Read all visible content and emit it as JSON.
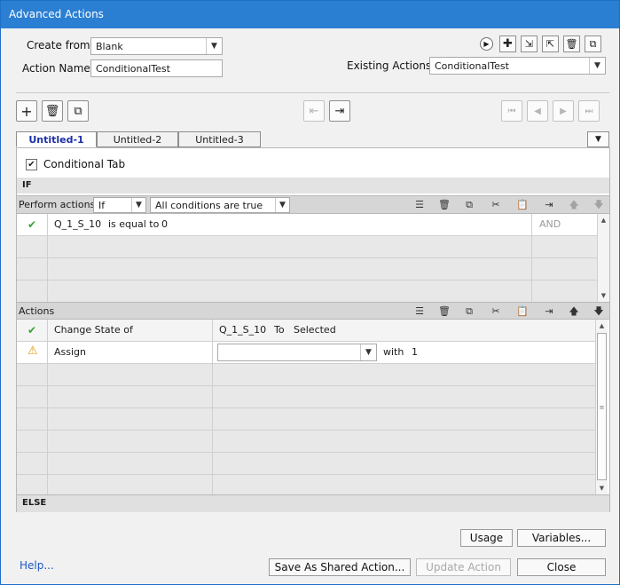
{
  "window": {
    "title": "Advanced Actions"
  },
  "form": {
    "create_from_label": "Create from:",
    "create_from_value": "Blank",
    "action_name_label": "Action Name:",
    "action_name_value": "ConditionalTest",
    "existing_actions_label": "Existing Actions:",
    "existing_actions_value": "ConditionalTest"
  },
  "header_icons": [
    "preview-icon",
    "add-icon",
    "import-icon",
    "export-icon",
    "delete-icon",
    "duplicate-icon"
  ],
  "toolbar": {
    "left_icons": [
      "plus-icon",
      "trash-icon",
      "copy-icon"
    ],
    "center_icons": [
      "remove-condition-icon",
      "add-condition-icon"
    ],
    "nav_icons": [
      "first-icon",
      "prev-icon",
      "next-icon",
      "last-icon"
    ]
  },
  "tabs": [
    {
      "label": "Untitled-1",
      "active": true
    },
    {
      "label": "Untitled-2",
      "active": false
    },
    {
      "label": "Untitled-3",
      "active": false
    }
  ],
  "conditional_tab": {
    "label": "Conditional Tab",
    "checked": true
  },
  "if_section": {
    "band_label": "IF",
    "perform_label": "Perform actions:",
    "perform_value": "If",
    "conditions_value": "All conditions are true",
    "rows": [
      {
        "variable": "Q_1_S_10",
        "operator": "is equal to",
        "value": "0",
        "logic": "AND"
      }
    ]
  },
  "actions_section": {
    "label": "Actions",
    "rows": [
      {
        "status": "check",
        "action": "Change State of",
        "detail": {
          "target": "Q_1_S_10",
          "to_label": "To",
          "state": "Selected"
        }
      },
      {
        "status": "warning",
        "action": "Assign",
        "detail": {
          "dropdown": "",
          "with_label": "with",
          "value": "1"
        }
      }
    ]
  },
  "else_label": "ELSE",
  "buttons": {
    "usage": "Usage",
    "variables": "Variables...",
    "help": "Help...",
    "save_shared": "Save As Shared Action...",
    "update": "Update Action",
    "close": "Close"
  },
  "colors": {
    "titlebar": "#2b7fd3",
    "active_tab_text": "#1c2fa8",
    "link": "#1f57c6"
  }
}
